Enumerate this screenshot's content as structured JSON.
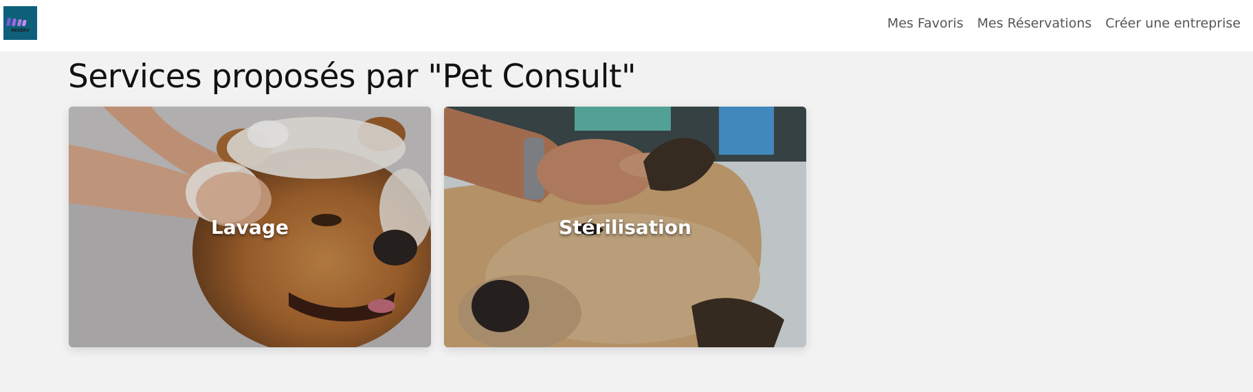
{
  "navbar": {
    "logo_icon": "reserv-logo-icon",
    "logo_text": "RESERV",
    "links": [
      {
        "label": "Mes Favoris"
      },
      {
        "label": "Mes Réservations"
      },
      {
        "label": "Créer une entreprise"
      }
    ]
  },
  "main": {
    "title": "Services proposés par \"Pet Consult\"",
    "services": [
      {
        "label": "Lavage",
        "image": "dog-bath-photo"
      },
      {
        "label": "Stérilisation",
        "image": "dog-vet-photo"
      }
    ]
  },
  "colors": {
    "background": "#f2f2f2",
    "navbar": "#ffffff",
    "logo_bg": "#0e5f7a",
    "nav_text": "#555555"
  }
}
